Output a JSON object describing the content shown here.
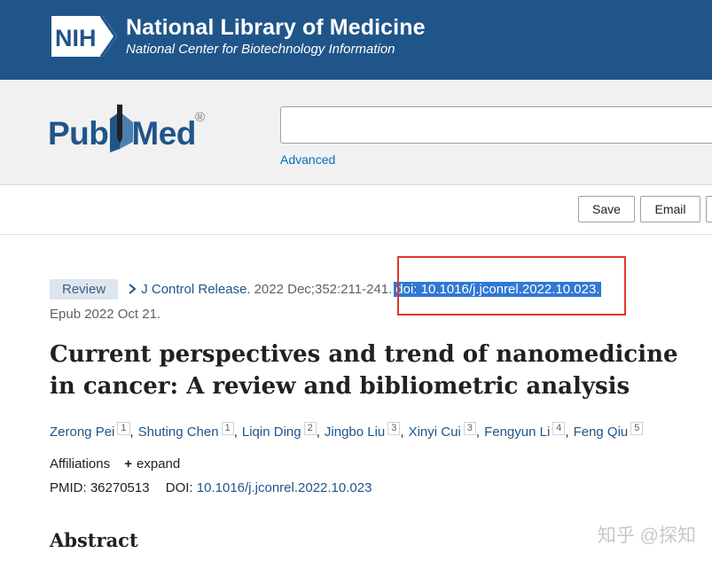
{
  "nih": {
    "logo_text": "NIH",
    "title": "National Library of Medicine",
    "subtitle": "National Center for Biotechnology Information"
  },
  "pubmed": {
    "logo_left": "Pub",
    "logo_right": "Med",
    "registered": "®",
    "search_value": "",
    "advanced_label": "Advanced"
  },
  "toolbar": {
    "save_label": "Save",
    "email_label": "Email"
  },
  "article": {
    "badge": "Review",
    "journal": "J Control Release.",
    "citation": "2022 Dec;352:211-241.",
    "doi_highlighted": "doi: 10.1016/j.jconrel.2022.10.023.",
    "epub": "Epub 2022 Oct 21.",
    "title": "Current perspectives and trend of nanomedicine in cancer: A review and bibliometric analysis",
    "authors": [
      {
        "name": "Zerong Pei",
        "aff": "1"
      },
      {
        "name": "Shuting Chen",
        "aff": "1"
      },
      {
        "name": "Liqin Ding",
        "aff": "2"
      },
      {
        "name": "Jingbo Liu",
        "aff": "3"
      },
      {
        "name": "Xinyi Cui",
        "aff": "3"
      },
      {
        "name": "Fengyun Li",
        "aff": "4"
      },
      {
        "name": "Feng Qiu",
        "aff": "5"
      }
    ],
    "affiliations_label": "Affiliations",
    "expand_label": "expand",
    "pmid_label": "PMID:",
    "pmid": "36270513",
    "doi_label": "DOI:",
    "doi": "10.1016/j.jconrel.2022.10.023",
    "abstract_heading": "Abstract"
  },
  "watermark": "知乎 @探知",
  "colors": {
    "nih_blue": "#20558a",
    "link": "#20558a",
    "highlight": "#3178d4",
    "annotation_red": "#e0362b"
  }
}
